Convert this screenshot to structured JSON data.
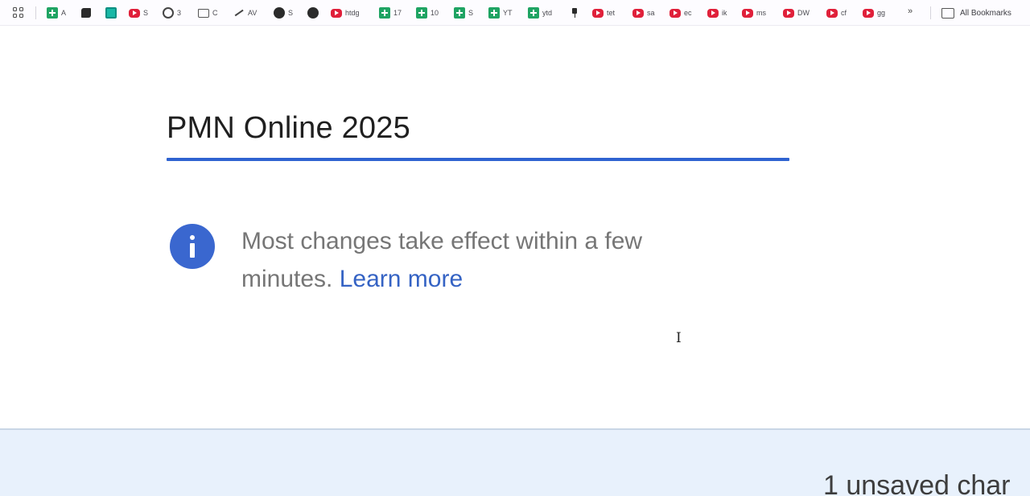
{
  "bookmarks_bar": {
    "apps_icon": "apps-grid-icon",
    "items": [
      {
        "label": "A",
        "icon": "sheets-icon"
      },
      {
        "label": "",
        "icon": "puzzle-icon"
      },
      {
        "label": "",
        "icon": "teal-app-icon"
      },
      {
        "label": "S",
        "icon": "youtube-icon"
      },
      {
        "label": "3",
        "icon": "circle-icon"
      },
      {
        "label": "C",
        "icon": "folder-icon"
      },
      {
        "label": "AV",
        "icon": "trend-line-icon"
      },
      {
        "label": "S",
        "icon": "globe-icon"
      },
      {
        "label": "",
        "icon": "github-icon"
      },
      {
        "label": "htdg",
        "icon": "youtube-icon"
      },
      {
        "label": "17",
        "icon": "sheets-icon"
      },
      {
        "label": "10",
        "icon": "sheets-icon"
      },
      {
        "label": "S",
        "icon": "sheets-icon"
      },
      {
        "label": "YT",
        "icon": "sheets-icon"
      },
      {
        "label": "ytd",
        "icon": "sheets-icon"
      },
      {
        "label": "",
        "icon": "pin-icon"
      },
      {
        "label": "tet",
        "icon": "youtube-icon"
      },
      {
        "label": "sa",
        "icon": "youtube-icon"
      },
      {
        "label": "ec",
        "icon": "youtube-icon"
      },
      {
        "label": "ik",
        "icon": "youtube-icon"
      },
      {
        "label": "ms",
        "icon": "youtube-icon"
      },
      {
        "label": "DW",
        "icon": "youtube-icon"
      },
      {
        "label": "cf",
        "icon": "youtube-icon"
      },
      {
        "label": "gg",
        "icon": "youtube-icon"
      }
    ],
    "more_label": "»",
    "all_bookmarks_label": "All Bookmarks"
  },
  "main": {
    "title_value": "PMN Online 2025",
    "info_icon": "info-icon",
    "info_text": "Most changes take effect within a few minutes.",
    "info_link": "Learn more"
  },
  "footer": {
    "unsaved_text": "1 unsaved char"
  },
  "colors": {
    "accent": "#2f63d1",
    "info_icon": "#3a67cf",
    "link": "#3563c4",
    "footer_bg": "#e8f1fc"
  }
}
